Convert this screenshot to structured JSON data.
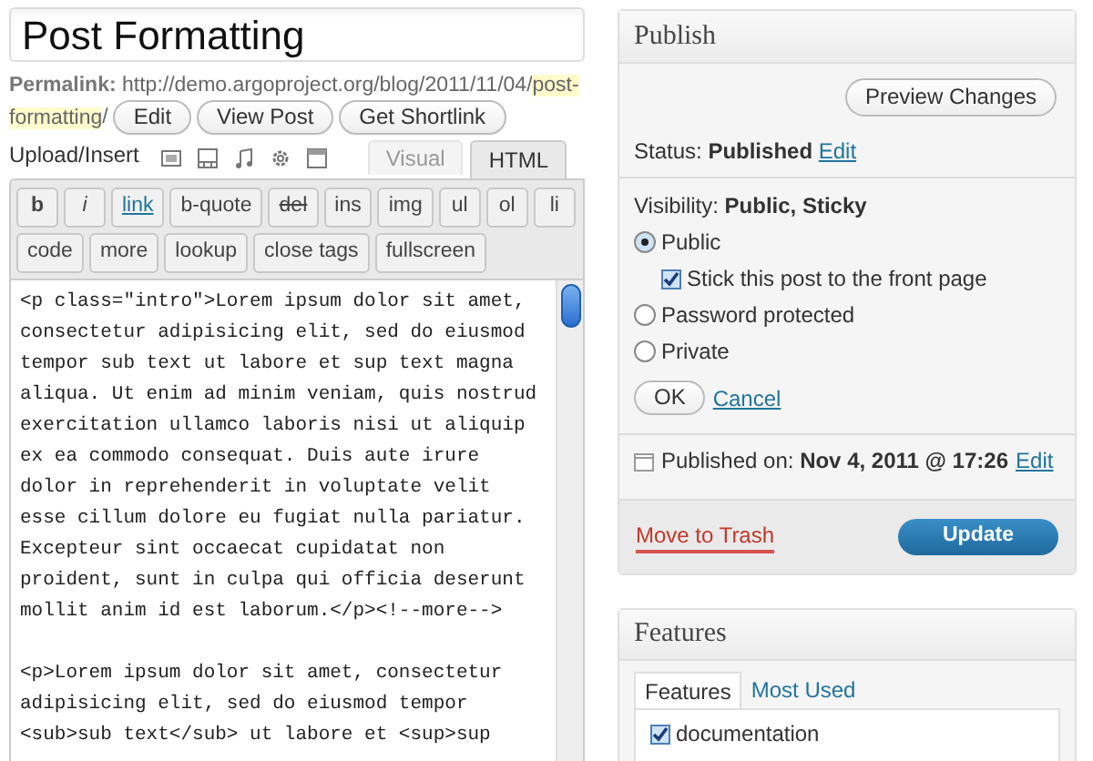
{
  "title_field": {
    "value": "Post Formatting"
  },
  "permalink": {
    "label": "Permalink:",
    "url_base": "http://demo.argoproject.org/blog/2011/11/04/",
    "slug_parts": [
      "post-",
      "formatting"
    ],
    "trailing": "/",
    "buttons": [
      "Edit",
      "View Post",
      "Get Shortlink"
    ]
  },
  "upload_insert": {
    "label": "Upload/Insert"
  },
  "editor_tabs": [
    {
      "label": "Visual",
      "selected": false
    },
    {
      "label": "HTML",
      "selected": true
    }
  ],
  "toolbar_rows": [
    [
      {
        "label": "b",
        "kind": "bold"
      },
      {
        "label": "i",
        "kind": "italic"
      },
      {
        "label": "link",
        "kind": "link"
      },
      {
        "label": "b-quote",
        "kind": "plain"
      },
      {
        "label": "del",
        "kind": "strike"
      },
      {
        "label": "ins",
        "kind": "plain"
      },
      {
        "label": "img",
        "kind": "plain"
      },
      {
        "label": "ul",
        "kind": "plain"
      },
      {
        "label": "ol",
        "kind": "plain"
      },
      {
        "label": "li",
        "kind": "plain"
      }
    ],
    [
      {
        "label": "code",
        "kind": "plain"
      },
      {
        "label": "more",
        "kind": "plain"
      },
      {
        "label": "lookup",
        "kind": "plain"
      },
      {
        "label": "close tags",
        "kind": "plain"
      },
      {
        "label": "fullscreen",
        "kind": "plain"
      }
    ]
  ],
  "editor_paragraphs": [
    [
      "<p class=\"intro\">Lorem ipsum dolor sit amet,",
      "consectetur adipisicing elit, sed do eiusmod",
      "tempor sub text ut labore et sup text magna",
      "aliqua. Ut enim ad minim veniam, quis nostrud",
      "exercitation ullamco laboris nisi ut aliquip",
      "ex ea commodo consequat. Duis aute irure",
      "dolor in reprehenderit in voluptate velit",
      "esse cillum dolore eu fugiat nulla pariatur.",
      "Excepteur sint occaecat cupidatat non",
      "proident, sunt in culpa qui officia deserunt",
      "mollit anim id est laborum.</p><!--more-->"
    ],
    [
      "<p>Lorem ipsum dolor sit amet, consectetur",
      "adipisicing elit, sed do eiusmod tempor",
      "<sub>sub text</sub> ut labore et <sup>sup"
    ]
  ],
  "publish": {
    "title": "Publish",
    "preview_button": "Preview Changes",
    "status": {
      "label": "Status:",
      "value": "Published",
      "link": "Edit"
    },
    "visibility": {
      "label": "Visibility:",
      "value": "Public, Sticky",
      "options": [
        {
          "label": "Public",
          "selected": true
        },
        {
          "label": "Password protected",
          "selected": false
        },
        {
          "label": "Private",
          "selected": false
        }
      ],
      "sticky": {
        "label": "Stick this post to the front page",
        "checked": true
      },
      "ok_button": "OK",
      "cancel_link": "Cancel"
    },
    "published_on": {
      "label": "Published on:",
      "value": "Nov 4, 2011 @ 17:26",
      "link": "Edit"
    },
    "trash_link": "Move to Trash",
    "update_button": "Update"
  },
  "features": {
    "title": "Features",
    "tabs": [
      {
        "label": "Features",
        "selected": true
      },
      {
        "label": "Most Used",
        "selected": false
      }
    ],
    "items": [
      {
        "label": "documentation",
        "checked": true
      }
    ]
  }
}
